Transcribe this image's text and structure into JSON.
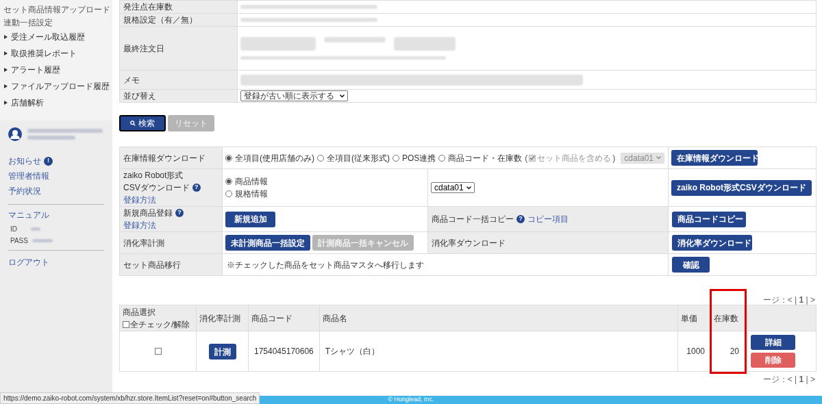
{
  "sidebar": {
    "sub_items": [
      "セット商品情報アップロード",
      "連動一括設定"
    ],
    "menu_items": [
      "受注メール取込履歴",
      "取扱推奨レポート",
      "アラート履歴",
      "ファイルアップロード履歴",
      "店舗解析"
    ],
    "links": [
      {
        "label": "お知らせ",
        "badge": "!"
      },
      {
        "label": "管理者情報"
      },
      {
        "label": "予約状況"
      }
    ],
    "manual": "マニュアル",
    "id_label": "ID",
    "pass_label": "PASS",
    "logout": "ログアウト"
  },
  "search_form": {
    "rows": [
      {
        "label": "発注点在庫数",
        "kind": "blurred"
      },
      {
        "label": "規格設定（有／無）",
        "kind": "blurred"
      },
      {
        "label": "最終注文日",
        "kind": "blurred_tall"
      },
      {
        "label": "メモ",
        "kind": "blurred_field"
      },
      {
        "label": "並び替え",
        "kind": "select",
        "value": "登録が古い順に表示する"
      }
    ],
    "buttons": [
      {
        "label": "検索",
        "disabled": false
      },
      {
        "label": "リセット",
        "disabled": true
      }
    ]
  },
  "actions": {
    "download": {
      "label": "在庫情報ダウンロード",
      "options": [
        {
          "label": "全項目(使用店舗のみ)",
          "selected": true
        },
        {
          "label": "全項目(従来形式)",
          "selected": false
        },
        {
          "label": "POS連携",
          "selected": false
        },
        {
          "label": "商品コード・在庫数",
          "selected": false
        }
      ],
      "include_set": {
        "open": "(",
        "label": "セット商品を含める",
        "close": ")",
        "checked": true,
        "disabled": true
      },
      "select": {
        "value": "cdata01",
        "disabled": true
      },
      "button": "在庫情報ダウンロード"
    },
    "csv": {
      "label_1": "zaiko Robot形式",
      "label_2": "CSVダウンロード",
      "help": "?",
      "link": "登録方法",
      "options": [
        {
          "label": "商品情報",
          "selected": true
        },
        {
          "label": "規格情報",
          "selected": false
        }
      ],
      "select": {
        "value": "cdata01",
        "disabled": false
      },
      "button": "zaiko Robot形式CSVダウンロード"
    },
    "new": {
      "label": "新規商品登録",
      "help": "?",
      "link": "登録方法",
      "button": "新規追加",
      "copy_label": "商品コード一括コピー",
      "copy_help": "?",
      "copy_link": "コピー項目",
      "copy_button": "商品コードコピー"
    },
    "rate": {
      "label": "消化率計測",
      "buttons": [
        {
          "label": "未計測商品一括設定",
          "disabled": false
        },
        {
          "label": "計測商品一括キャンセル",
          "disabled": true
        }
      ],
      "dl_label": "消化率ダウンロード",
      "dl_button": "消化率ダウンロード"
    },
    "set": {
      "label": "セット商品移行",
      "note": "※チェックした商品をセット商品マスタへ移行します",
      "button": "確認"
    }
  },
  "pagination_top": "ージ：< | **1** | >",
  "products": {
    "columns": [
      "商品選択",
      "消化率計測",
      "商品コード",
      "商品名",
      "単価",
      "在庫数"
    ],
    "check_all": "全チェック/解除",
    "check_all_checked": false,
    "rows": [
      {
        "checked": false,
        "measure_button": "計測",
        "code": "1754045170606",
        "name": "Tシャツ（白）",
        "price": "1000",
        "stock": "20",
        "detail_button": "詳細",
        "delete_button": "削除"
      }
    ]
  },
  "pagination_bottom": "ージ：< | **1** | >",
  "footer": "© Hunglead, Inc.",
  "status_url": "https://demo.zaiko-robot.com/system/xb/hzr.store.ItemList?reset=on#button_search"
}
